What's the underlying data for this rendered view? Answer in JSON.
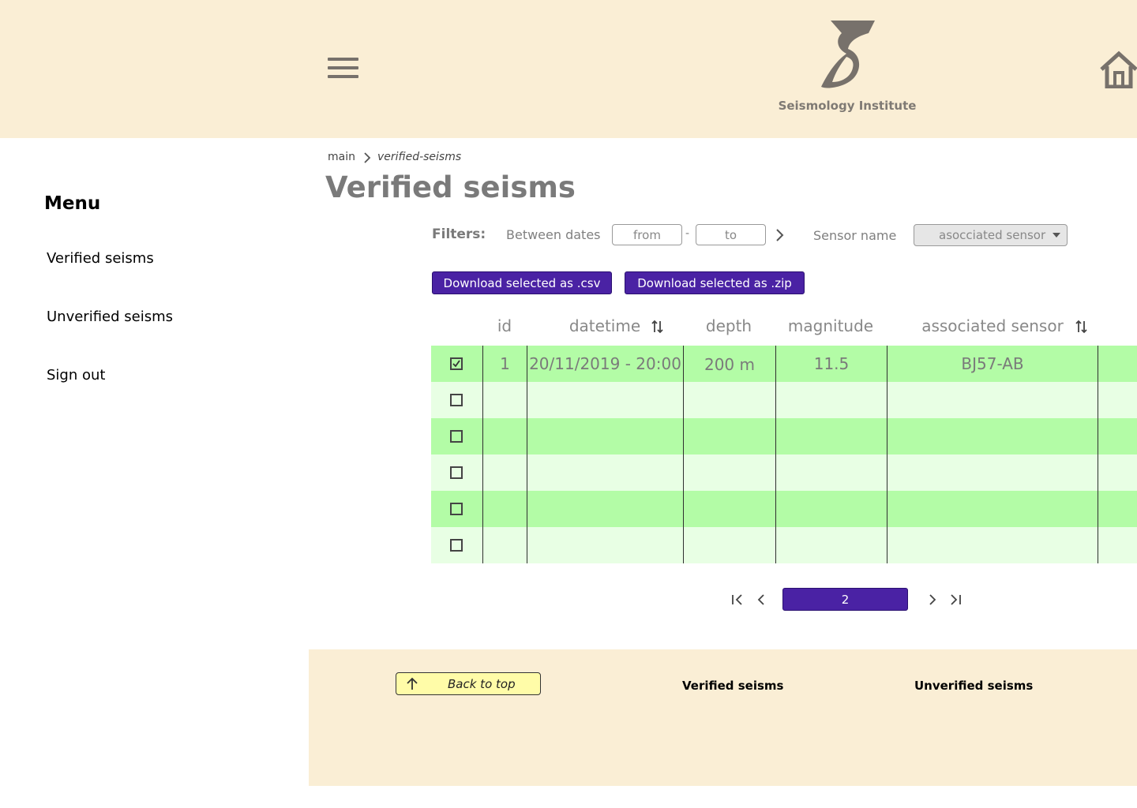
{
  "header": {
    "brand": "Seismology Institute",
    "icons": [
      "hamburger-menu-icon",
      "seismology-logo",
      "home-icon"
    ],
    "colors": {
      "header_bg": "#faeed5",
      "icon": "#77716b"
    }
  },
  "sidebar": {
    "title": "Menu",
    "items": [
      {
        "label": "Verified seisms"
      },
      {
        "label": "Unverified seisms"
      },
      {
        "label": "Sign out"
      }
    ]
  },
  "breadcrumb": {
    "root": "main",
    "current": "verified-seisms"
  },
  "page": {
    "title": "Verified seisms"
  },
  "filters": {
    "label": "Filters:",
    "between_dates": "Between dates",
    "from_placeholder": "from",
    "dash": "-",
    "to_placeholder": "to",
    "sensor_label": "Sensor name",
    "sensor_selected": "asocciated sensor"
  },
  "actions": {
    "csv_label": "Download selected as .csv",
    "zip_label": "Download selected as .zip",
    "accent": "#4a22a4"
  },
  "table": {
    "headers": [
      "id",
      "datetime",
      "depth",
      "magnitude",
      "associated sensor"
    ],
    "rows": [
      {
        "checked": true,
        "id": "1",
        "datetime": "20/11/2019 - 20:00",
        "depth": "200 m",
        "magnitude": "11.5",
        "sensor": "BJ57-AB"
      },
      {
        "checked": false,
        "id": "",
        "datetime": "",
        "depth": "",
        "magnitude": "",
        "sensor": ""
      },
      {
        "checked": false,
        "id": "",
        "datetime": "",
        "depth": "",
        "magnitude": "",
        "sensor": ""
      },
      {
        "checked": false,
        "id": "",
        "datetime": "",
        "depth": "",
        "magnitude": "",
        "sensor": ""
      },
      {
        "checked": false,
        "id": "",
        "datetime": "",
        "depth": "",
        "magnitude": "",
        "sensor": ""
      },
      {
        "checked": false,
        "id": "",
        "datetime": "",
        "depth": "",
        "magnitude": "",
        "sensor": ""
      }
    ],
    "row_colors": {
      "dark": "#b3fca6",
      "light": "#e8ffe4"
    }
  },
  "pagination": {
    "current_page": "2"
  },
  "footer": {
    "back_to_top": "Back to top",
    "links": [
      "Verified seisms",
      "Unverified seisms"
    ]
  }
}
